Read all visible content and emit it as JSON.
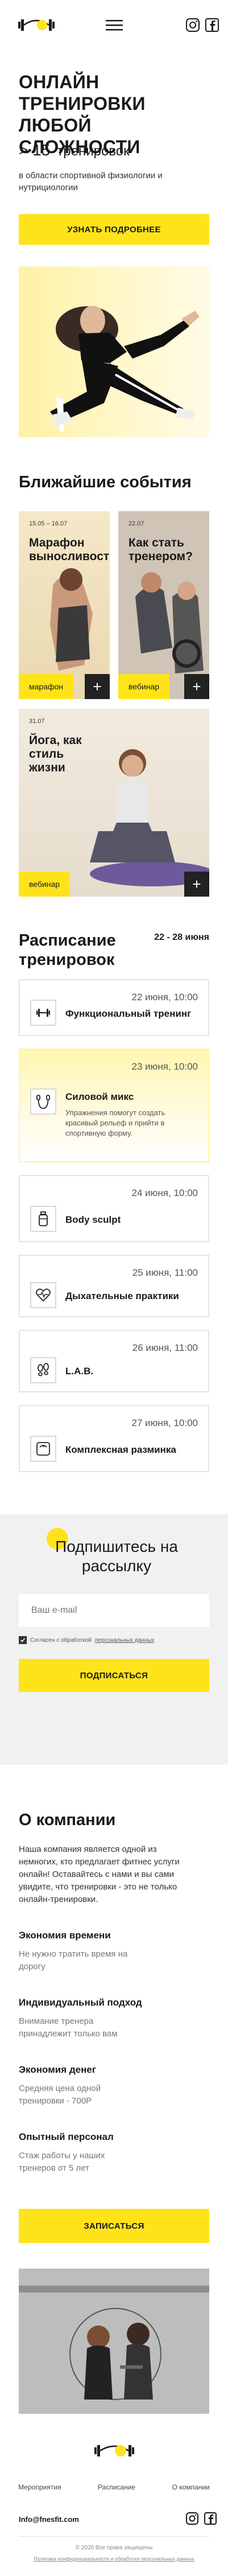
{
  "header": {
    "logo_alt": "dumbbell-logo"
  },
  "hero": {
    "title": "ОНЛАЙН ТРЕНИРОВКИ ЛЮБОЙ СЛОЖНОСТИ",
    "count_prefix": "> 15",
    "count_label": "тренировок",
    "subtitle": "в области спортивной физиологии и нутрициологии",
    "cta": "УЗНАТЬ ПОДРОБНЕЕ"
  },
  "events": {
    "title": "Ближайшие события",
    "items": [
      {
        "date": "15.05 – 16.07",
        "title": "Марафон выносливости",
        "tag": "марафон"
      },
      {
        "date": "22.07",
        "title": "Как стать тренером?",
        "tag": "вебинар"
      },
      {
        "date": "31.07",
        "title": "Йога, как стиль жизни",
        "tag": "вебинар"
      }
    ]
  },
  "schedule": {
    "title": "Расписание тренировок",
    "range": "22 - 28 июня",
    "items": [
      {
        "date": "22 июня, 10:00",
        "name": "Функциональный тренинг",
        "icon": "barbell-icon"
      },
      {
        "date": "23 июня, 10:00",
        "name": "Силовой микс",
        "icon": "jump-rope-icon",
        "desc": "Упражнения помогут создать красивый рельеф и прийти в спортивную форму."
      },
      {
        "date": "24 июня, 10:00",
        "name": "Body sculpt",
        "icon": "bottle-icon"
      },
      {
        "date": "25 июня, 11:00",
        "name": "Дыхательные практики",
        "icon": "heart-pulse-icon"
      },
      {
        "date": "26 июня, 11:00",
        "name": "L.A.B.",
        "icon": "footprints-icon"
      },
      {
        "date": "27 июня, 10:00",
        "name": "Комплексная разминка",
        "icon": "scale-icon"
      }
    ]
  },
  "subscribe": {
    "title": "Подпишитесь на рассылку",
    "placeholder": "Ваш e-mail",
    "agree_text": "Согласен с обработкой",
    "agree_link": "персональных данных",
    "button": "ПОДПИСАТЬСЯ"
  },
  "about": {
    "title": "О компании",
    "text": "Наша компания является одной из немногих, кто предлагает фитнес услуги онлайн! Оставайтесь с нами и вы сами увидите, что тренировки - это не только онлайн-тренировки.",
    "benefits": [
      {
        "title": "Экономия времени",
        "text": "Не нужно тратить время на дорогу"
      },
      {
        "title": "Индивидуальный подход",
        "text": "Внимание тренера принадлежит только вам"
      },
      {
        "title": "Экономия денег",
        "text": "Средняя цена одной тренировки - 700Р"
      },
      {
        "title": "Опытный персонал",
        "text": "Стаж работы у наших тренеров от 5 лет"
      }
    ],
    "cta": "ЗАПИСАТЬСЯ"
  },
  "footer": {
    "nav": [
      "Мероприятия",
      "Расписание",
      "О компании"
    ],
    "email": "Info@fnesfit.com",
    "copyright": "© 2020 Все права защищены",
    "policy": "Политика конфиденциальности и обработки персональных данных"
  },
  "colors": {
    "accent": "#ffe31a",
    "text": "#1a1a1a",
    "muted": "#777777"
  }
}
